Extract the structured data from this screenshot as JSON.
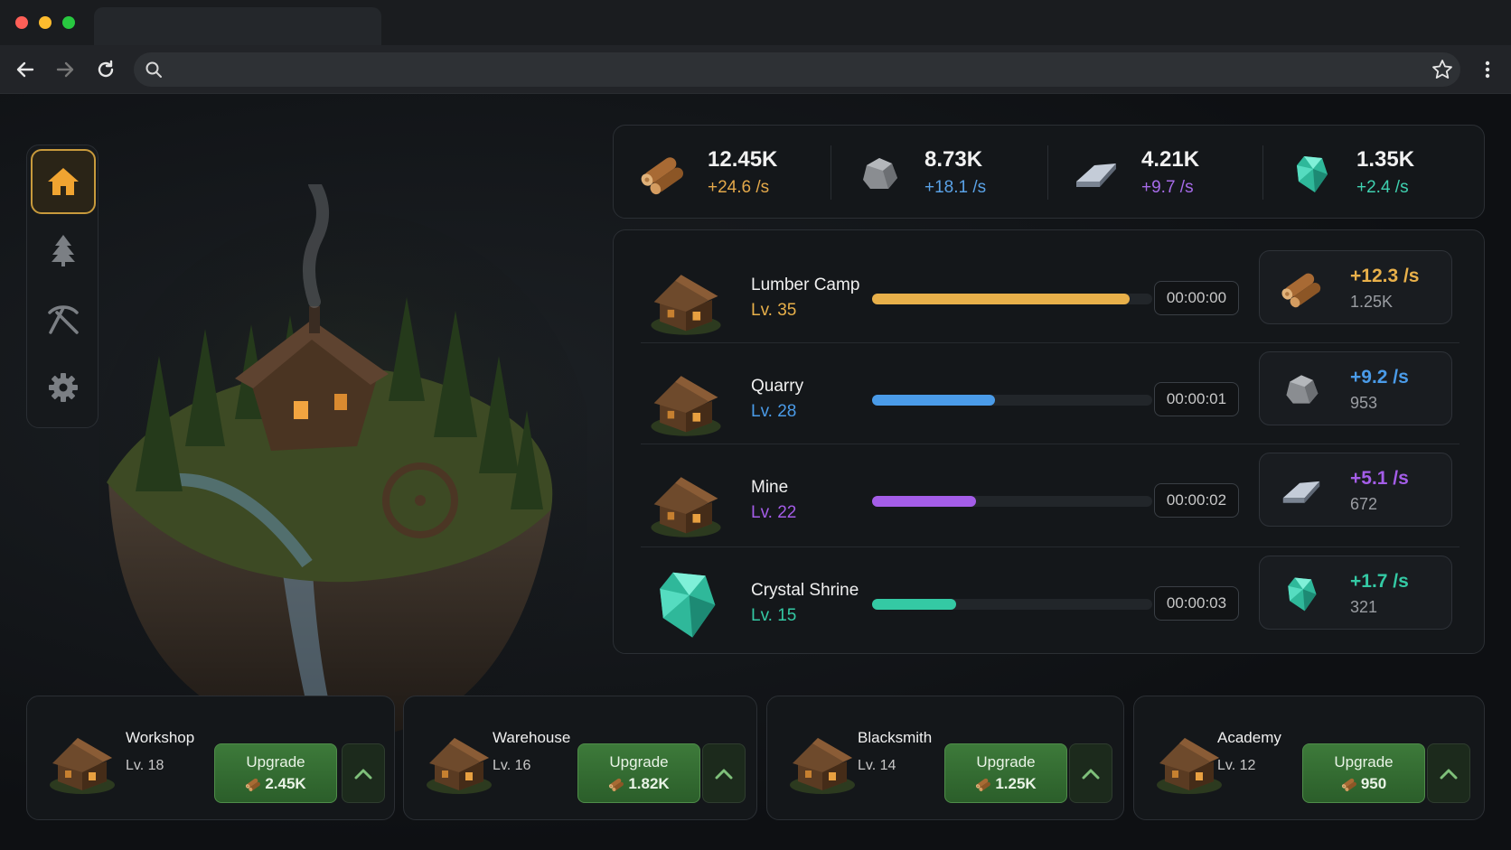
{
  "browser": {
    "controls": [
      "close",
      "minimize",
      "maximize"
    ],
    "colors": {
      "close": "#ff5f57",
      "minimize": "#febc2e",
      "maximize": "#28c840"
    },
    "omnibox_placeholder": ""
  },
  "sidebar": {
    "items": [
      {
        "icon": "home-icon",
        "active": true
      },
      {
        "icon": "tree-icon",
        "active": false
      },
      {
        "icon": "pickaxe-icon",
        "active": false
      },
      {
        "icon": "gear-icon",
        "active": false
      }
    ]
  },
  "resources": [
    {
      "icon": "wood-icon",
      "amount": "12.45K",
      "rate": "+24.6 /s",
      "color": "#e3a84a"
    },
    {
      "icon": "stone-icon",
      "amount": "8.73K",
      "rate": "+18.1 /s",
      "color": "#5aa2e6"
    },
    {
      "icon": "iron-icon",
      "amount": "4.21K",
      "rate": "+9.7 /s",
      "color": "#a66be8"
    },
    {
      "icon": "crystal-icon",
      "amount": "1.35K",
      "rate": "+2.4 /s",
      "color": "#3fd1b0"
    }
  ],
  "production": [
    {
      "name": "Lumber Camp",
      "level": "Lv. 35",
      "progress": 0.92,
      "timer": "00:00:00",
      "rate": "+12.3 /s",
      "stored": "1.25K",
      "color": "#e8b04a",
      "output_icon": "wood-icon"
    },
    {
      "name": "Quarry",
      "level": "Lv. 28",
      "progress": 0.44,
      "timer": "00:00:01",
      "rate": "+9.2 /s",
      "stored": "953",
      "color": "#4a9be8",
      "output_icon": "stone-icon"
    },
    {
      "name": "Mine",
      "level": "Lv. 22",
      "progress": 0.37,
      "timer": "00:00:02",
      "rate": "+5.1 /s",
      "stored": "672",
      "color": "#a45de8",
      "output_icon": "iron-icon"
    },
    {
      "name": "Crystal Shrine",
      "level": "Lv. 15",
      "progress": 0.3,
      "timer": "00:00:03",
      "rate": "+1.7 /s",
      "stored": "321",
      "color": "#34c9a4",
      "output_icon": "crystal-icon"
    }
  ],
  "buildings": [
    {
      "name": "Workshop",
      "level": "Lv. 18",
      "button": "Upgrade",
      "cost": "2.45K"
    },
    {
      "name": "Warehouse",
      "level": "Lv. 16",
      "button": "Upgrade",
      "cost": "1.82K"
    },
    {
      "name": "Blacksmith",
      "level": "Lv. 14",
      "button": "Upgrade",
      "cost": "1.25K"
    },
    {
      "name": "Academy",
      "level": "Lv. 12",
      "button": "Upgrade",
      "cost": "950"
    }
  ]
}
